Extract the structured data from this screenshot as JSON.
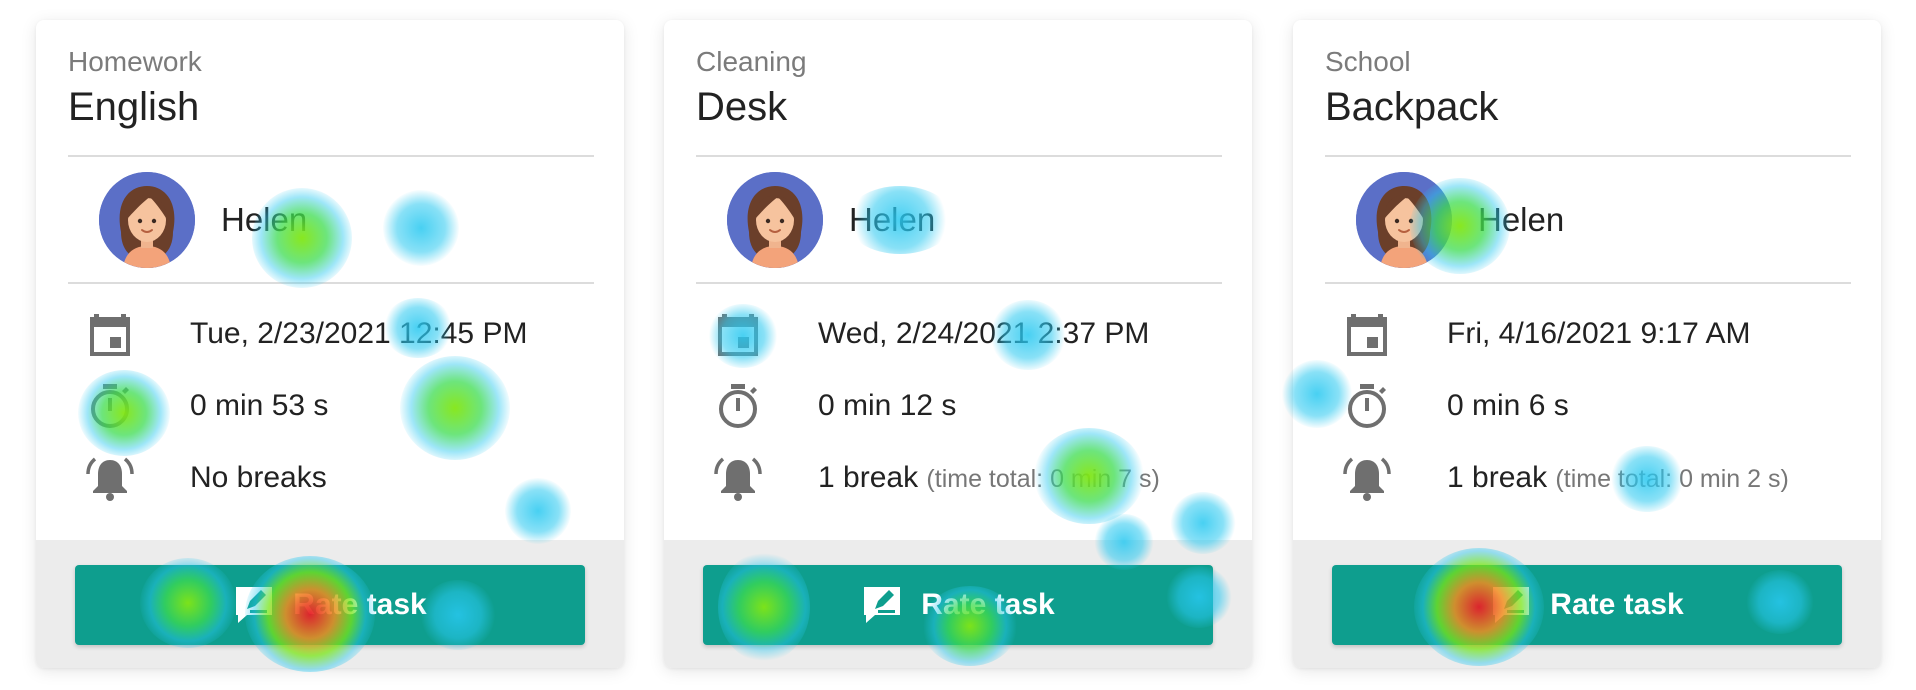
{
  "cards": [
    {
      "category": "Homework",
      "title": "English",
      "person": {
        "name": "Helen",
        "avatar_icon": "avatar-girl-icon"
      },
      "date": "Tue, 2/23/2021 12:45 PM",
      "duration": "0 min 53 s",
      "breaks": "No breaks",
      "break_detail": "",
      "button": {
        "label": "Rate task",
        "icon": "rate-edit-icon"
      }
    },
    {
      "category": "Cleaning",
      "title": "Desk",
      "person": {
        "name": "Helen",
        "avatar_icon": "avatar-girl-icon"
      },
      "date": "Wed, 2/24/2021 2:37 PM",
      "duration": "0 min 12 s",
      "breaks": "1 break",
      "break_detail": "(time total: 0 min 7 s)",
      "button": {
        "label": "Rate task",
        "icon": "rate-edit-icon"
      }
    },
    {
      "category": "School",
      "title": "Backpack",
      "person": {
        "name": "Helen",
        "avatar_icon": "avatar-girl-icon"
      },
      "date": "Fri, 4/16/2021 9:17 AM",
      "duration": "0 min 6 s",
      "breaks": "1 break",
      "break_detail": "(time total: 0 min 2 s)",
      "button": {
        "label": "Rate task",
        "icon": "rate-edit-icon"
      }
    }
  ],
  "colors": {
    "button": "#0e9e8e",
    "icon_gray": "#6f6f6f",
    "avatar_bg": "#5b6fc7",
    "card_footer": "#ececec"
  }
}
